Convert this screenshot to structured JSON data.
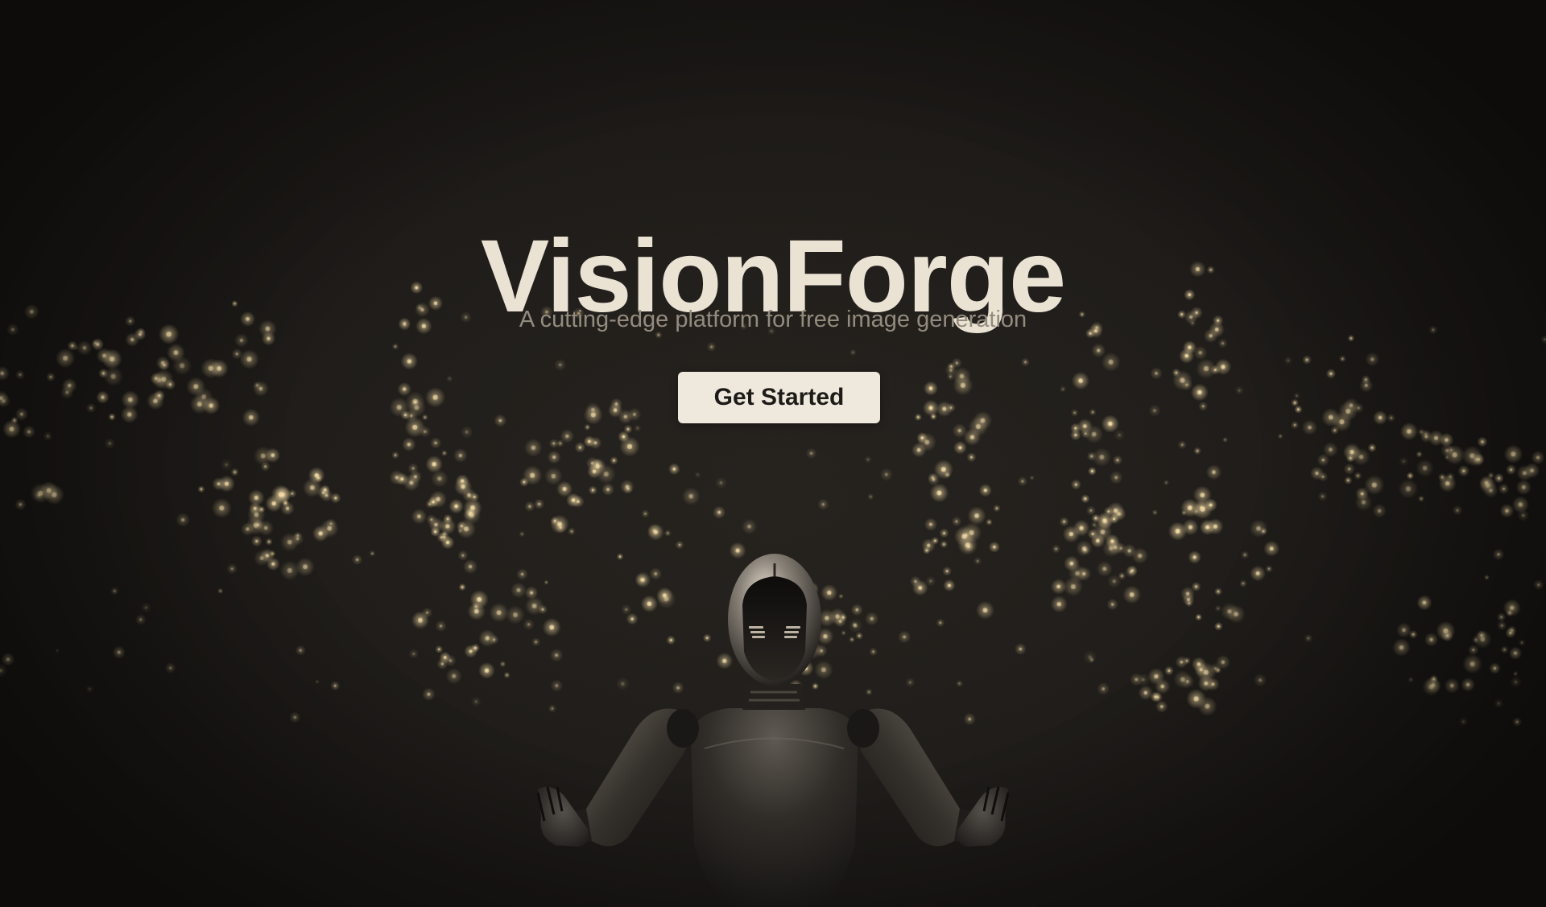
{
  "hero": {
    "title": "VisionForge",
    "subtitle": "A cutting-edge platform for free image generation",
    "cta_label": "Get Started"
  },
  "colors": {
    "background": "#1d1b18",
    "title": "#eae2d3",
    "subtitle": "#948b7f",
    "button_bg": "#efe8dc",
    "button_text": "#1d1b18",
    "particle_glow": "#f3dca6"
  }
}
